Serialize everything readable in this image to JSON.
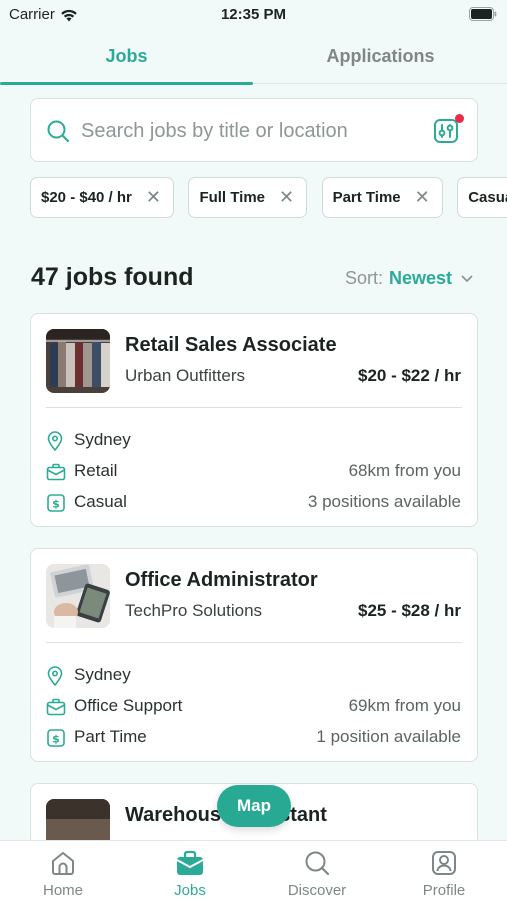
{
  "status_bar": {
    "carrier": "Carrier",
    "time": "12:35 PM"
  },
  "tabs": [
    {
      "label": "Jobs",
      "active": true
    },
    {
      "label": "Applications",
      "active": false
    }
  ],
  "search": {
    "placeholder": "Search jobs by title or location",
    "value": ""
  },
  "filter_chips": [
    "$20 - $40 / hr",
    "Full Time",
    "Part Time",
    "Casual"
  ],
  "results": {
    "count_text": "47 jobs found",
    "sort_label": "Sort:",
    "sort_value": "Newest"
  },
  "jobs": [
    {
      "title": "Retail Sales Associate",
      "company": "Urban Outfitters",
      "pay": "$20 - $22 / hr",
      "location": "Sydney",
      "category": "Retail",
      "distance": "68km from you",
      "type": "Casual",
      "positions": "3 positions available"
    },
    {
      "title": "Office Administrator",
      "company": "TechPro Solutions",
      "pay": "$25 - $28 / hr",
      "location": "Sydney",
      "category": "Office Support",
      "distance": "69km from you",
      "type": "Part Time",
      "positions": "1 position available"
    },
    {
      "title": "Warehouse Assistant"
    }
  ],
  "map_button": "Map",
  "bottom_nav": [
    {
      "label": "Home",
      "icon": "home-icon",
      "active": false
    },
    {
      "label": "Jobs",
      "icon": "briefcase-icon",
      "active": true
    },
    {
      "label": "Discover",
      "icon": "search-icon",
      "active": false
    },
    {
      "label": "Profile",
      "icon": "profile-icon",
      "active": false
    }
  ],
  "colors": {
    "accent": "#2bab97",
    "background": "#f1faf8",
    "badge": "#ee2a4b"
  }
}
